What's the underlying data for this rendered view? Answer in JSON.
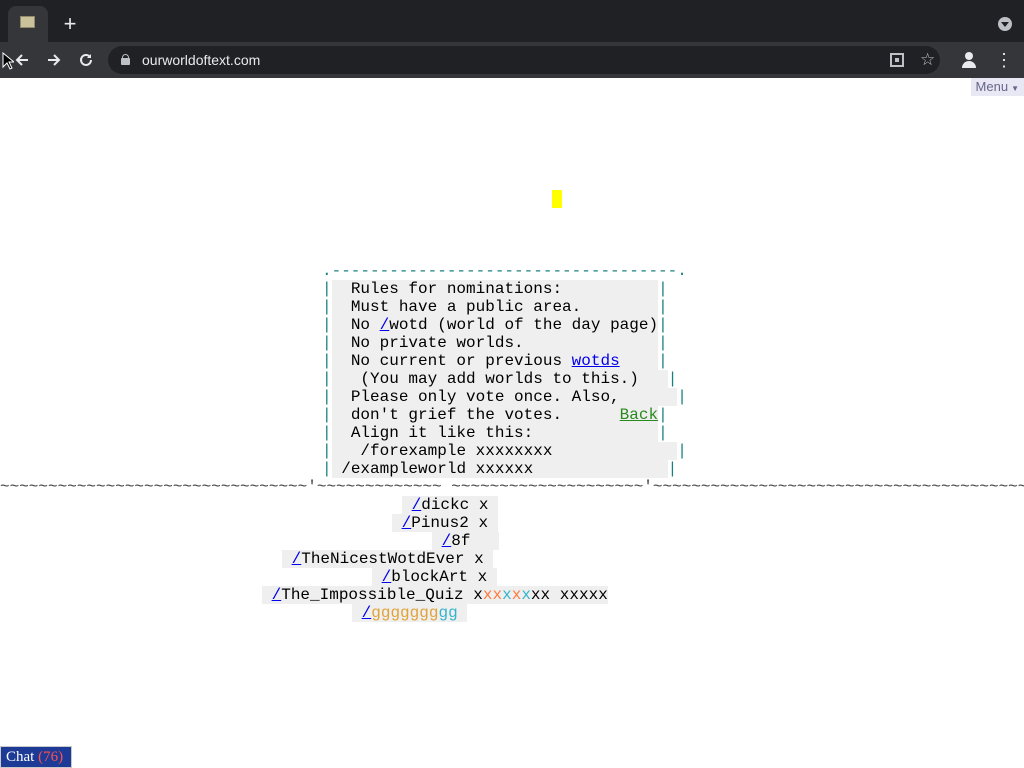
{
  "browser": {
    "url": "ourworldoftext.com",
    "new_tab_symbol": "+",
    "icons": [
      "favicon",
      "plus-icon",
      "tab-search-icon",
      "back-arrow-icon",
      "forward-arrow-icon",
      "reload-icon",
      "lock-icon",
      "qr-code-icon",
      "star-icon",
      "profile-icon",
      "kebab-menu-icon"
    ]
  },
  "page": {
    "menu_label": "Menu",
    "rules_box": {
      "border_color": "#1b7f7f",
      "lines": [
        "Rules for nominations:",
        "Must have a public area.",
        "No /wotd (world of the day page)",
        "No private worlds.",
        "No current or previous wotds",
        "(You may add worlds to this.)",
        "Please only vote once. Also,",
        "don't grief the votes.",
        "Align it like this:",
        "/forexample xxxxxxxx",
        "/exampleworld xxxxxx"
      ],
      "links": {
        "wotd": "/",
        "wotds": "wotds",
        "back": "Back"
      }
    },
    "nominations": [
      {
        "slash": "/",
        "name": "dickc",
        "votes": "x"
      },
      {
        "slash": "/",
        "name": "Pinus2",
        "votes": "x"
      },
      {
        "slash": "/",
        "name": "8f",
        "votes": ""
      },
      {
        "slash": "/",
        "name": "TheNicestWotdEver",
        "votes": "x"
      },
      {
        "slash": "/",
        "name": "blockArt",
        "votes": "x"
      },
      {
        "slash": "/",
        "name": "The_Impossible_Quiz",
        "votes": "xxxxxxxx xxxxx"
      },
      {
        "slash": "/",
        "name": "ggggggggg",
        "votes": ""
      }
    ],
    "chat": {
      "label": "Chat",
      "count": "(76)"
    }
  },
  "colors": {
    "chrome_dark": "#202124",
    "chrome_toolbar": "#35363a",
    "link": "#0000ee",
    "back_link": "#2a8a1e",
    "chat_bg": "#1c3a96",
    "chat_count": "#ff5050",
    "cursor_highlight": "#ffff00"
  }
}
